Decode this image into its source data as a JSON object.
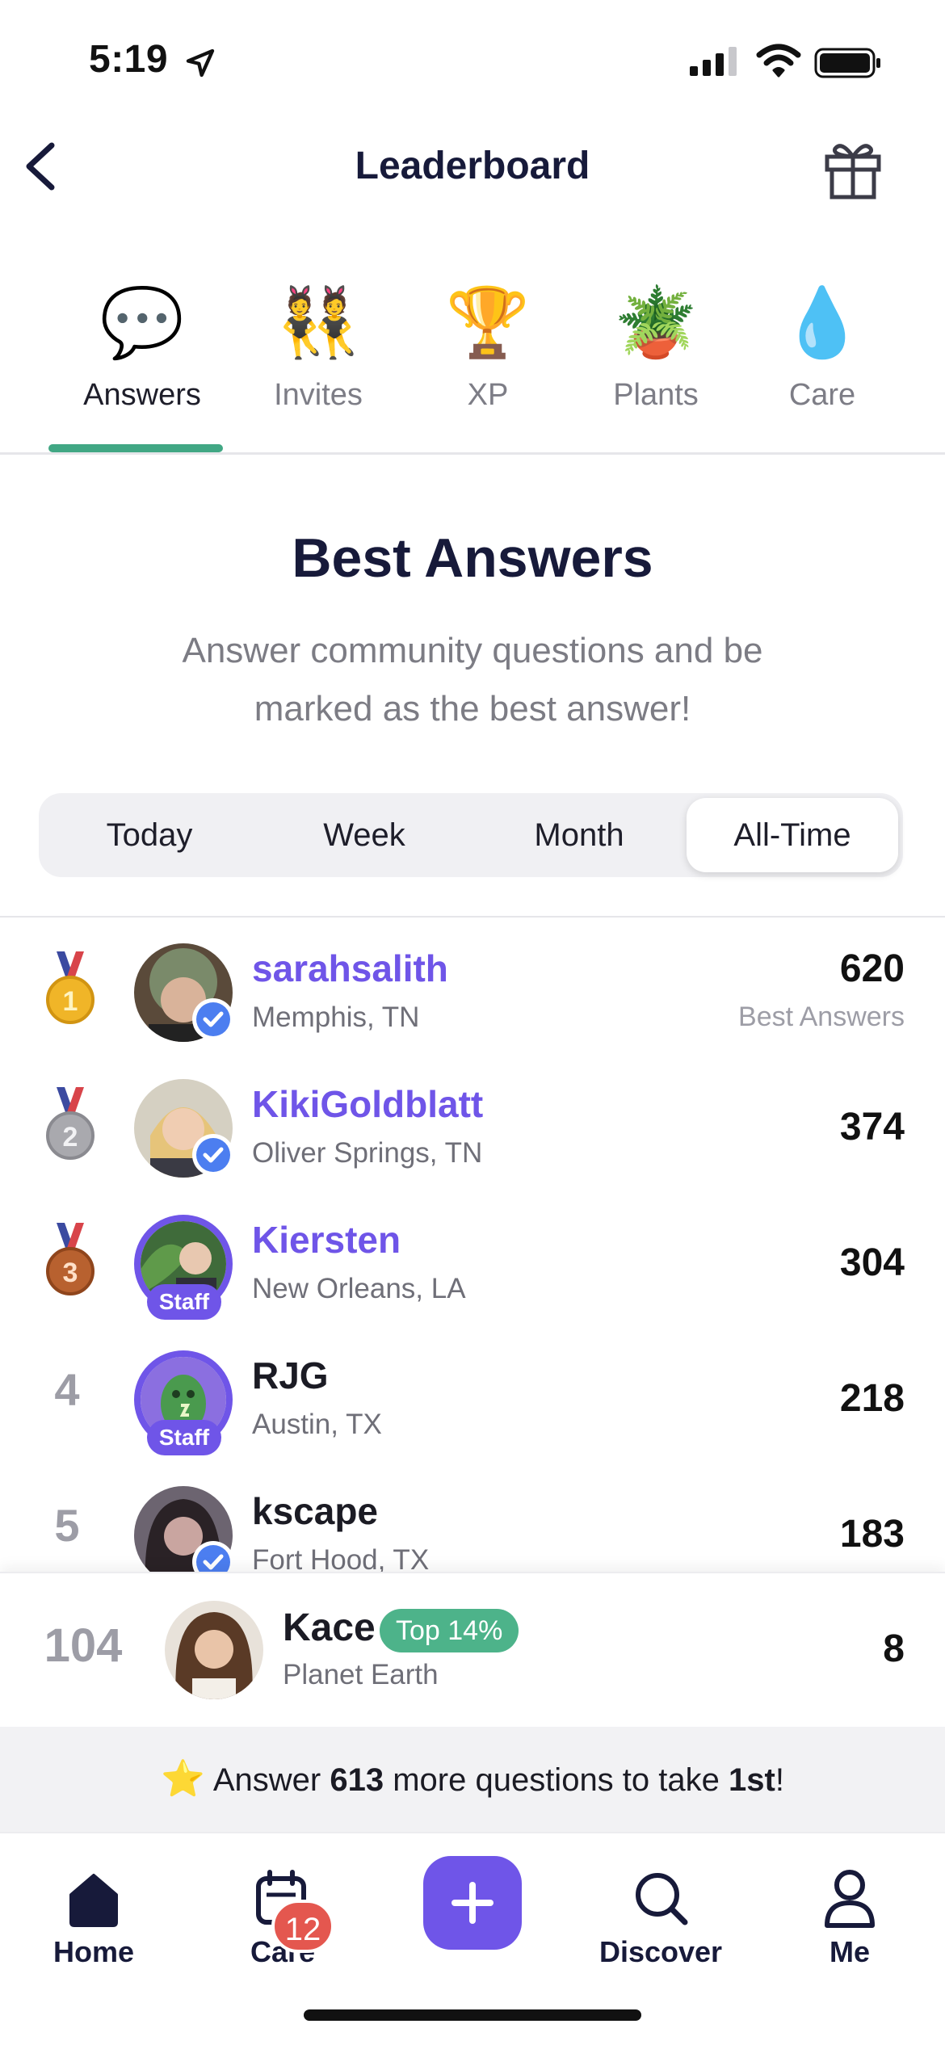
{
  "status_bar": {
    "time": "5:19"
  },
  "header": {
    "title": "Leaderboard"
  },
  "category_tabs": [
    {
      "emoji": "💬",
      "label": "Answers",
      "active": true
    },
    {
      "emoji": "👯",
      "label": "Invites",
      "active": false
    },
    {
      "emoji": "🏆",
      "label": "XP",
      "active": false
    },
    {
      "emoji": "🪴",
      "label": "Plants",
      "active": false
    },
    {
      "emoji": "💧",
      "label": "Care",
      "active": false
    }
  ],
  "hero": {
    "title": "Best Answers",
    "subtitle": "Answer community questions and be marked as the best answer!"
  },
  "periods": {
    "selected": "All-Time",
    "items": [
      "Today",
      "Week",
      "Month",
      "All-Time"
    ]
  },
  "leaders": [
    {
      "rank": "1",
      "name": "sarahsalith",
      "location": "Memphis, TN",
      "score": "620",
      "score_unit": "Best Answers",
      "badge": "verified"
    },
    {
      "rank": "2",
      "name": "KikiGoldblatt",
      "location": "Oliver Springs, TN",
      "score": "374",
      "badge": "verified"
    },
    {
      "rank": "3",
      "name": "Kiersten",
      "location": "New Orleans, LA",
      "score": "304",
      "badge": "Staff"
    },
    {
      "rank": "4",
      "name": "RJG",
      "location": "Austin, TX",
      "score": "218",
      "badge": "Staff"
    },
    {
      "rank": "5",
      "name": "kscape",
      "location": "Fort Hood, TX",
      "score": "183",
      "badge": "verified"
    }
  ],
  "me": {
    "rank": "104",
    "name": "Kace",
    "badge": "Top 14%",
    "location": "Planet Earth",
    "score": "8"
  },
  "hint": {
    "prefix": "Answer ",
    "count": "613",
    "middle": " more questions to take ",
    "place": "1st",
    "suffix": "!"
  },
  "nav": {
    "items": [
      {
        "label": "Home",
        "icon": "home-icon"
      },
      {
        "label": "Care",
        "icon": "calendar-icon",
        "badge": "12"
      },
      {
        "label": "Discover",
        "icon": "search-icon"
      },
      {
        "label": "Me",
        "icon": "person-icon"
      }
    ]
  },
  "colors": {
    "accent": "#6f55e8",
    "green": "#41a784",
    "badge_red": "#e4574f"
  }
}
